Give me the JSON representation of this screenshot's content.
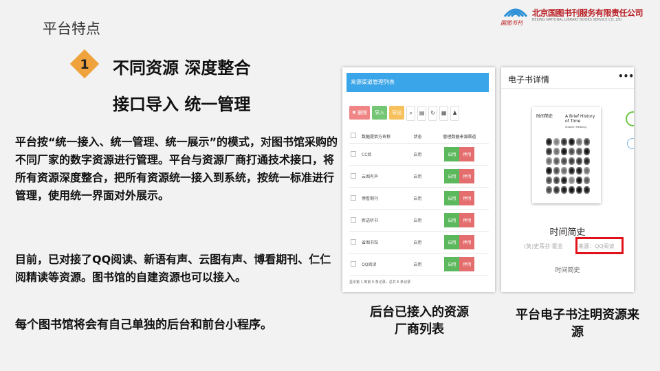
{
  "section_title": "平台特点",
  "logo": {
    "brand": "国图书刊",
    "org_name": "北京国图书刊服务有限责任公司",
    "org_name_en": "BEIJING NATIONAL LIBRARY BOOKS SERVICE CO.,LTD"
  },
  "feature": {
    "number": "1",
    "line1": "不同资源   深度整合",
    "line2": "接口导入   统一管理"
  },
  "paragraphs": [
    "平台按“统一接入、统一管理、统一展示”的模式，对图书馆采购的不同厂家的数字资源进行管理。平台与资源厂商打通技术接口，将所有资源深度整合，把所有资源统一接入到系统，按统一标准进行管理，使用统一界面对外展示。",
    "目前，已对接了QQ阅读、新语有声、云图有声、博看期刊、仁仁阅精读等资源。图书馆的自建资源也可以接入。",
    "每个图书馆将会有自己单独的后台和前台小程序。"
  ],
  "admin_screenshot": {
    "header": "来源渠道管理列表",
    "toolbar": [
      "✖ 删除",
      "导入",
      "导出"
    ],
    "toolbar_icons": [
      "search-icon",
      "print-icon",
      "refresh-icon",
      "columns-icon",
      "user-icon"
    ],
    "columns": [
      "数据提供方名称",
      "状态",
      "管理数据来源渠道"
    ],
    "rows": [
      {
        "name": "CC阅",
        "status": "启用"
      },
      {
        "name": "云图有声",
        "status": "启用"
      },
      {
        "name": "博看期刊",
        "status": "启用"
      },
      {
        "name": "新语听书",
        "status": "启用"
      },
      {
        "name": "省图书馆",
        "status": "启用"
      },
      {
        "name": "QQ阅读",
        "status": "启用"
      }
    ],
    "enable_label": "启用",
    "disable_label": "停用",
    "footer": "显示第 1 到第 6 条记录，总共 6 条记录"
  },
  "ebook_screenshot": {
    "title": "电子书详情",
    "menu": "•••",
    "cover_cn": "时间简史",
    "cover_en": "A Brief History of Time",
    "cover_author": "Stephen Hawking",
    "book_title": "时间简史",
    "author": "(英)史蒂芬·霍金",
    "source": "来源：QQ阅读",
    "subtitle": "时间简史"
  },
  "captions": {
    "left": "后台已接入的资源厂商列表",
    "right": "平台电子书注明资源来源"
  }
}
